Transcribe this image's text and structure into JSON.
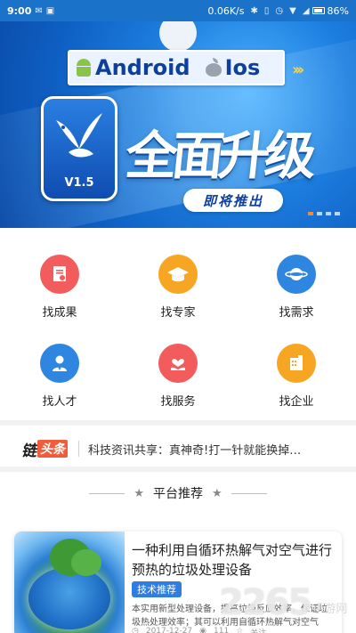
{
  "status_bar": {
    "time": "9:00",
    "network_speed": "0.06K/s",
    "battery": "86%"
  },
  "banner": {
    "platform_android": "Android",
    "platform_ios": "Ios",
    "version": "V1.5",
    "headline": "全面升级",
    "coming_soon": "即将推出",
    "page_indicator": {
      "count": 4,
      "active_index": 0
    }
  },
  "grid": {
    "items": [
      {
        "label": "找成果",
        "icon": "certificate-icon",
        "color": "#f25c5c"
      },
      {
        "label": "找专家",
        "icon": "graduation-cap-icon",
        "color": "#f6a623"
      },
      {
        "label": "找需求",
        "icon": "planet-icon",
        "color": "#2f86e0"
      },
      {
        "label": "找人才",
        "icon": "person-icon",
        "color": "#2f86e0"
      },
      {
        "label": "找服务",
        "icon": "heart-hand-icon",
        "color": "#f25c5c"
      },
      {
        "label": "找企业",
        "icon": "building-icon",
        "color": "#f6a623"
      }
    ]
  },
  "ticker": {
    "logo_part1": "链",
    "logo_part2": "头条",
    "text": "科技资讯共享：真神奇!打一针就能换掉…"
  },
  "section": {
    "title": "平台推荐"
  },
  "card": {
    "title": "一种利用自循环热解气对空气进行预热的垃圾处理设备",
    "tag": "技术推荐",
    "description": "本实用新型处理设备，提高垃圾反应效率，保证垃圾热处理效率；其可以利用自循环热解气对空气",
    "date": "2017-12-27",
    "views": "111",
    "follow": "关注"
  },
  "watermark": {
    "number": "2265",
    "text": "手游网"
  }
}
